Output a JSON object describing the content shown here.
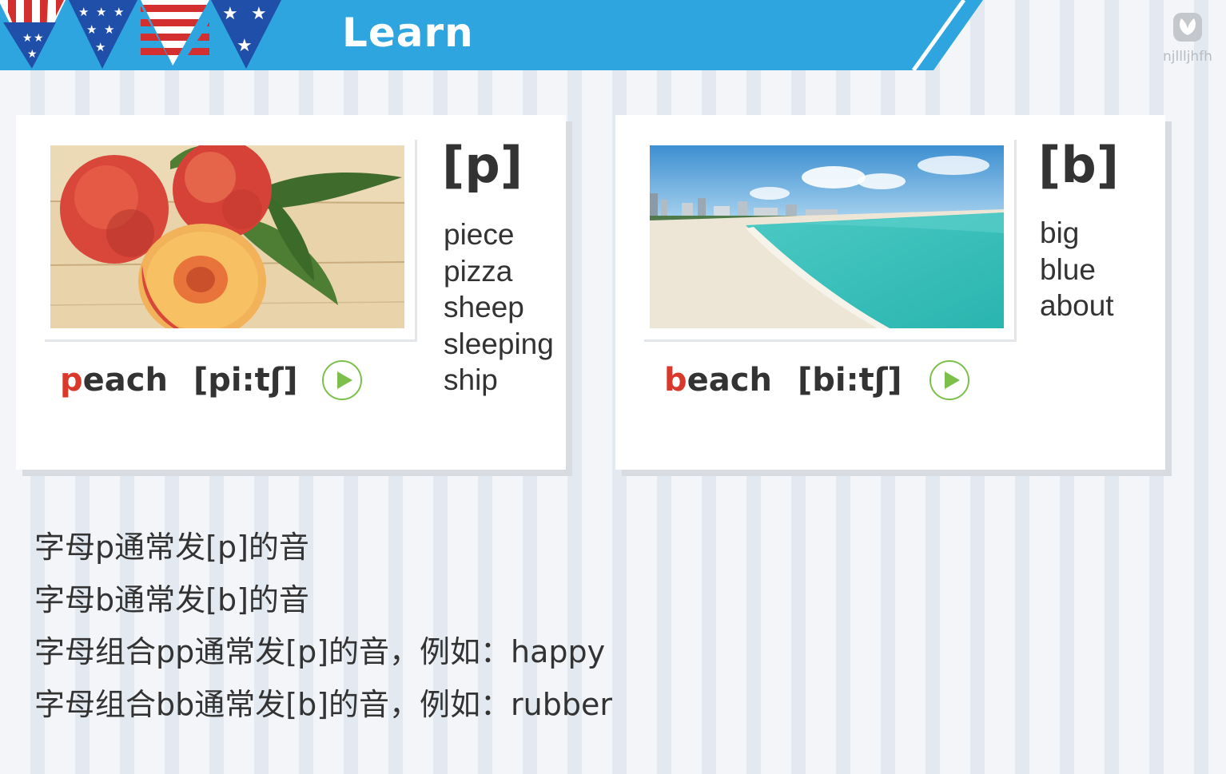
{
  "header": {
    "title": "Learn"
  },
  "watermark": {
    "text": "njllljhfh",
    "icon": "leaf-logo-icon"
  },
  "cards": [
    {
      "phoneme": "[p]",
      "words": [
        "piece",
        "pizza",
        "sheep",
        "sleeping",
        "ship"
      ],
      "keyword_initial": "p",
      "keyword_rest": "each",
      "phonetic": "[pi:tʃ]",
      "image": "peaches-photo",
      "play_icon": "play-icon"
    },
    {
      "phoneme": "[b]",
      "words": [
        "big",
        "blue",
        "about"
      ],
      "keyword_initial": "b",
      "keyword_rest": "each",
      "phonetic": "[bi:tʃ]",
      "image": "beach-photo",
      "play_icon": "play-icon"
    }
  ],
  "rules": [
    "字母p通常发[p]的音",
    "字母b通常发[b]的音",
    "字母组合pp通常发[p]的音，例如：happy",
    "字母组合bb通常发[b]的音，例如：rubber"
  ],
  "colors": {
    "banner_blue": "#2fa5e0",
    "keyword_red": "#d9382b",
    "play_green": "#7cbf4a",
    "text_dark": "#333333"
  }
}
